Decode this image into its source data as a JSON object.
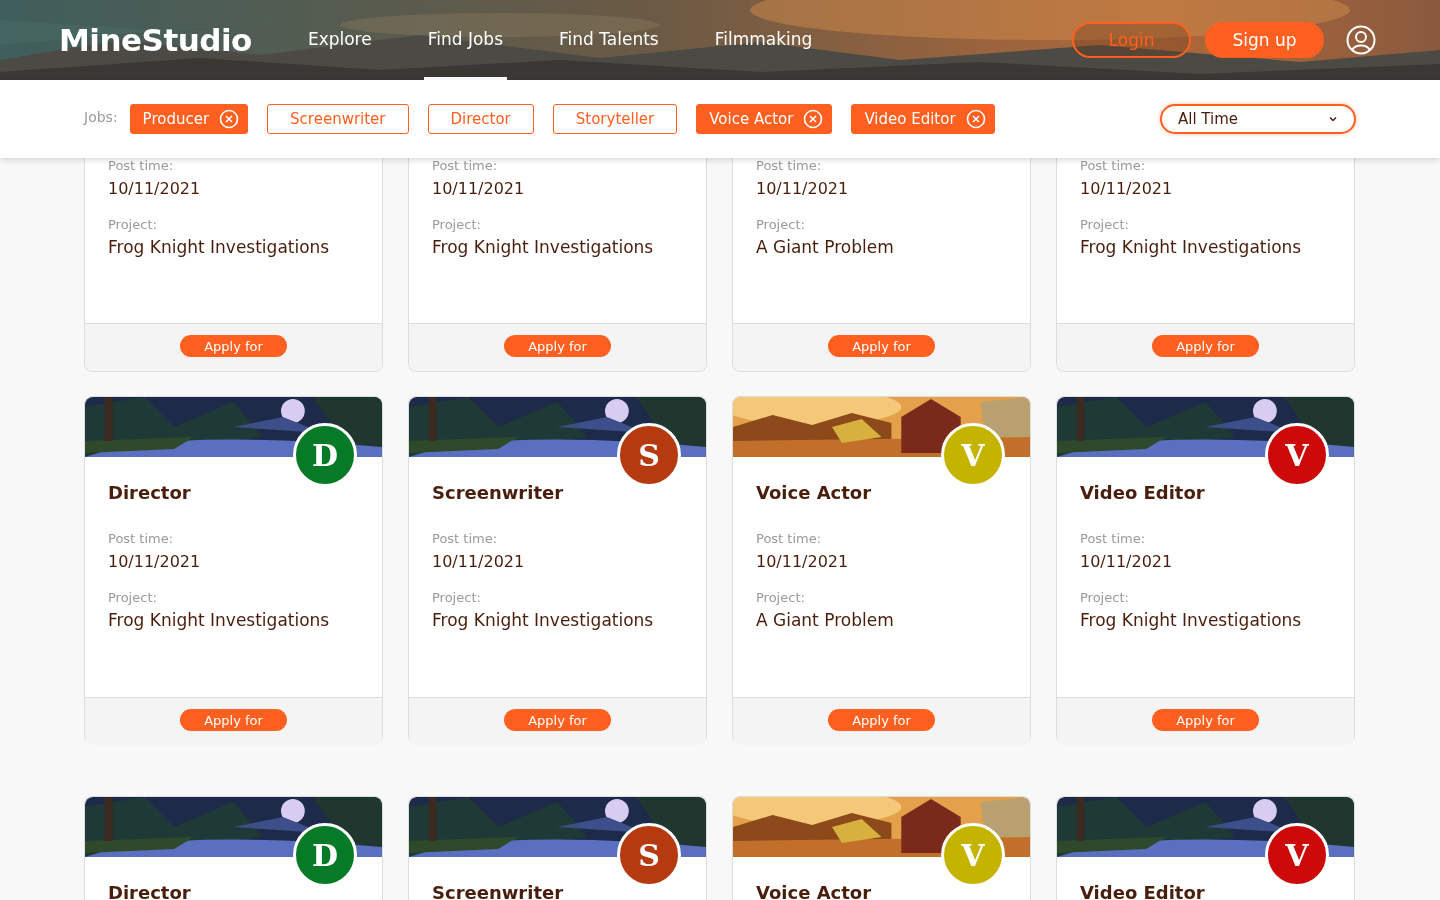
{
  "header": {
    "logo": "MineStudio",
    "nav": [
      {
        "label": "Explore",
        "selected": false
      },
      {
        "label": "Find Jobs",
        "selected": true
      },
      {
        "label": "Find Talents",
        "selected": false
      },
      {
        "label": "Filmmaking",
        "selected": false
      }
    ],
    "login": "Login",
    "signup": "Sign up"
  },
  "filters": {
    "label": "Jobs:",
    "chips": [
      {
        "label": "Producer",
        "selected": true
      },
      {
        "label": "Screenwriter",
        "selected": false
      },
      {
        "label": "Director",
        "selected": false
      },
      {
        "label": "Storyteller",
        "selected": false
      },
      {
        "label": "Voice Actor",
        "selected": true
      },
      {
        "label": "Video Editor",
        "selected": true
      }
    ],
    "period": "All Time"
  },
  "rows": [
    {
      "kind": "top",
      "cards": [
        {
          "post_time_label": "Post time:",
          "post_time": "10/11/2021",
          "project_label": "Project:",
          "project": "Frog Knight Investigations",
          "apply": "Apply for"
        },
        {
          "post_time_label": "Post time:",
          "post_time": "10/11/2021",
          "project_label": "Project:",
          "project": "Frog Knight Investigations",
          "apply": "Apply for"
        },
        {
          "post_time_label": "Post time:",
          "post_time": "10/11/2021",
          "project_label": "Project:",
          "project": "A Giant Problem",
          "apply": "Apply for"
        },
        {
          "post_time_label": "Post time:",
          "post_time": "10/11/2021",
          "project_label": "Project:",
          "project": "Frog Knight Investigations",
          "apply": "Apply for"
        }
      ]
    },
    {
      "kind": "full",
      "cards": [
        {
          "kind": "night",
          "avatar": "D",
          "color": "#067a26",
          "title": "Director",
          "post_time_label": "Post time:",
          "post_time": "10/11/2021",
          "project_label": "Project:",
          "project": "Frog Knight Investigations",
          "apply": "Apply for"
        },
        {
          "kind": "night",
          "avatar": "S",
          "color": "#b53a10",
          "title": "Screenwriter",
          "post_time_label": "Post time:",
          "post_time": "10/11/2021",
          "project_label": "Project:",
          "project": "Frog Knight Investigations",
          "apply": "Apply for"
        },
        {
          "kind": "farm",
          "avatar": "V",
          "color": "#c4b400",
          "title": "Voice Actor",
          "post_time_label": "Post time:",
          "post_time": "10/11/2021",
          "project_label": "Project:",
          "project": "A Giant Problem",
          "apply": "Apply for"
        },
        {
          "kind": "night",
          "avatar": "V",
          "color": "#cc0a0a",
          "title": "Video Editor",
          "post_time_label": "Post time:",
          "post_time": "10/11/2021",
          "project_label": "Project:",
          "project": "Frog Knight Investigations",
          "apply": "Apply for"
        }
      ]
    },
    {
      "kind": "bottom",
      "cards": [
        {
          "kind": "night",
          "avatar": "D",
          "color": "#067a26",
          "title": "Director"
        },
        {
          "kind": "night",
          "avatar": "S",
          "color": "#b53a10",
          "title": "Screenwriter"
        },
        {
          "kind": "farm",
          "avatar": "V",
          "color": "#c4b400",
          "title": "Voice Actor"
        },
        {
          "kind": "night",
          "avatar": "V",
          "color": "#cc0a0a",
          "title": "Video Editor"
        }
      ]
    }
  ]
}
